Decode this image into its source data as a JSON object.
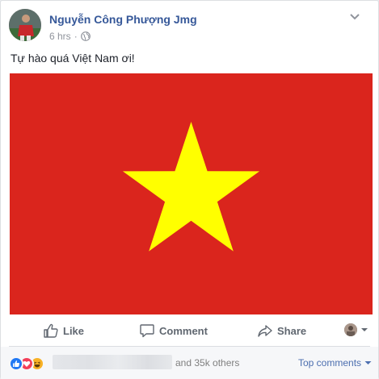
{
  "post": {
    "author": "Nguyễn Công Phượng Jmg",
    "timestamp": "6 hrs",
    "separator": "·",
    "audience_icon": "globe-icon",
    "text": "Tự hào quá Việt Nam ơi!",
    "image": {
      "background_color": "#da251d",
      "star_color": "#ffff00"
    }
  },
  "actions": {
    "like_label": "Like",
    "comment_label": "Comment",
    "share_label": "Share"
  },
  "reactions": {
    "icons": [
      "like-reaction-icon",
      "love-reaction-icon",
      "haha-reaction-icon"
    ],
    "others_text": "and 35k others",
    "top_comments_label": "Top comments"
  },
  "colors": {
    "link": "#365899",
    "action_text": "#606770",
    "meta_text": "#90949c",
    "like_blue": "#2078f4",
    "love_red": "#f33e58",
    "haha_yellow": "#f7b125"
  }
}
